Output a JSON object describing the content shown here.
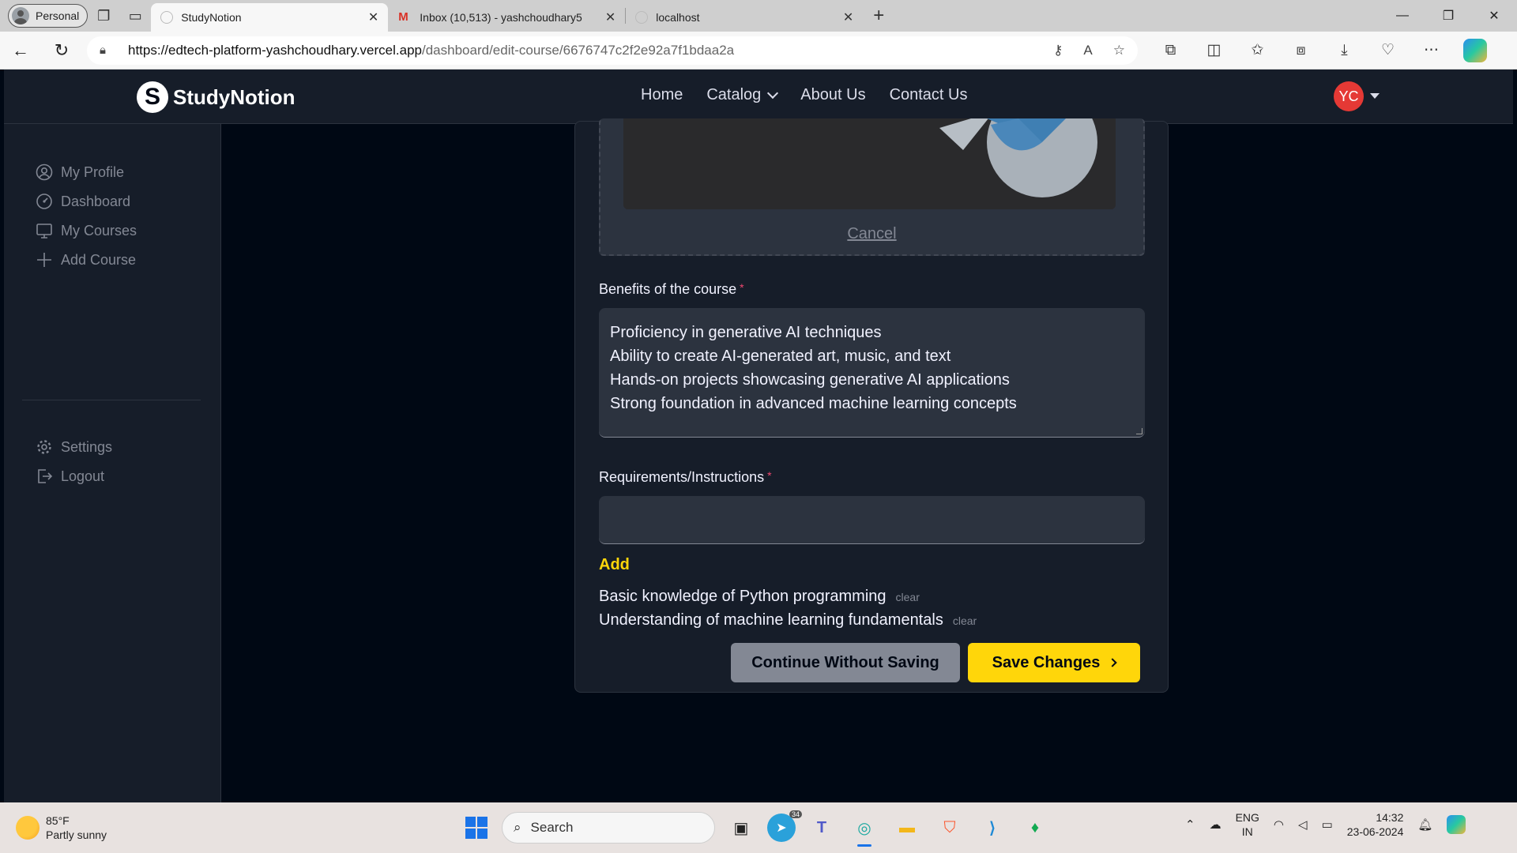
{
  "browser": {
    "profile_label": "Personal",
    "tabs": [
      {
        "title": "StudyNotion",
        "active": true
      },
      {
        "title": "Inbox (10,513) - yashchoudhary5",
        "active": false
      },
      {
        "title": "localhost",
        "active": false
      }
    ],
    "url_host": "https://edtech-platform-yashchoudhary.vercel.app",
    "url_path": "/dashboard/edit-course/6676747c2f2e92a7f1bdaa2a"
  },
  "navbar": {
    "logo_letter": "S",
    "logo_text": "StudyNotion",
    "links": [
      "Home",
      "Catalog",
      "About Us",
      "Contact Us"
    ],
    "avatar_initials": "YC"
  },
  "sidebar": {
    "items": [
      {
        "label": "My Profile",
        "icon": "user-circle-icon"
      },
      {
        "label": "Dashboard",
        "icon": "gauge-icon"
      },
      {
        "label": "My Courses",
        "icon": "monitor-icon"
      },
      {
        "label": "Add Course",
        "icon": "plus-icon"
      }
    ],
    "bottom_items": [
      {
        "label": "Settings",
        "icon": "gear-icon"
      },
      {
        "label": "Logout",
        "icon": "logout-icon"
      }
    ]
  },
  "form": {
    "thumbnail_cancel": "Cancel",
    "benefits_label": "Benefits of the course",
    "required_mark": "*",
    "benefits_lines": [
      "Proficiency in generative AI techniques",
      "Ability to create AI-generated art, music, and text",
      "Hands-on projects showcasing generative AI applications",
      "Strong foundation in advanced machine learning concepts"
    ],
    "requirements_label": "Requirements/Instructions",
    "requirements_input_value": "",
    "add_label": "Add",
    "requirements": [
      "Basic knowledge of Python programming",
      "Understanding of machine learning fundamentals"
    ],
    "clear_label": "clear",
    "continue_button": "Continue Without Saving",
    "save_button": "Save Changes"
  },
  "taskbar": {
    "weather_temp": "85°F",
    "weather_desc": "Partly sunny",
    "search_placeholder": "Search",
    "telegram_badge": "34",
    "lang_1": "ENG",
    "lang_2": "IN",
    "time": "14:32",
    "date": "23-06-2024"
  },
  "colors": {
    "bg": "#000814",
    "panel": "#161D29",
    "field": "#2C333F",
    "accent_yellow": "#FFD60A",
    "required_pink": "#EF476F",
    "avatar_red": "#E53935"
  }
}
